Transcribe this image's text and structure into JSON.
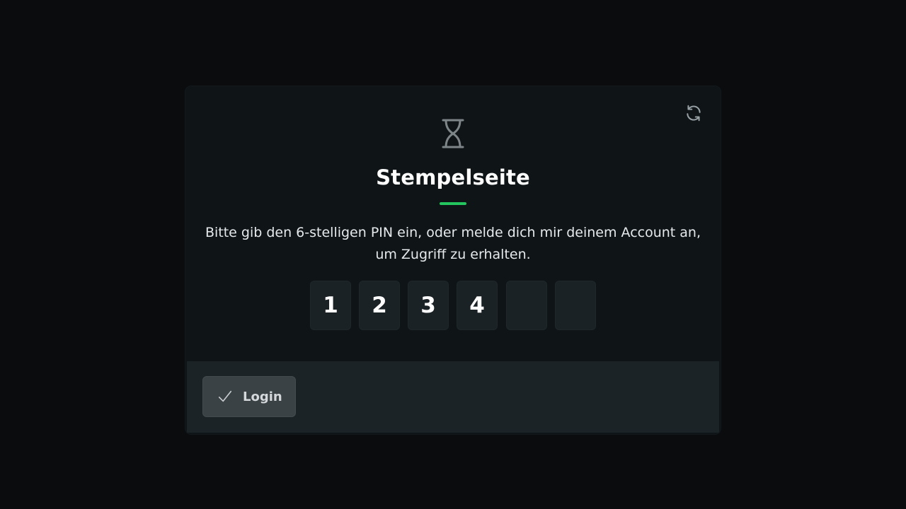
{
  "card": {
    "title": "Stempelseite",
    "description": "Bitte gib den 6-stelligen PIN ein, oder melde dich mir deinem Account an, um Zugriff zu erhalten.",
    "header_icon": "hourglass-icon",
    "refresh_icon": "refresh-icon"
  },
  "pin": {
    "digits": [
      "1",
      "2",
      "3",
      "4",
      "",
      ""
    ]
  },
  "footer": {
    "login_label": "Login",
    "login_icon": "check-icon"
  },
  "colors": {
    "background": "#0a0c0e",
    "card": "#0f1417",
    "footer": "#1c2327",
    "accent": "#22c55e",
    "pin_box": "#1b2226",
    "button": "#3a4246"
  }
}
